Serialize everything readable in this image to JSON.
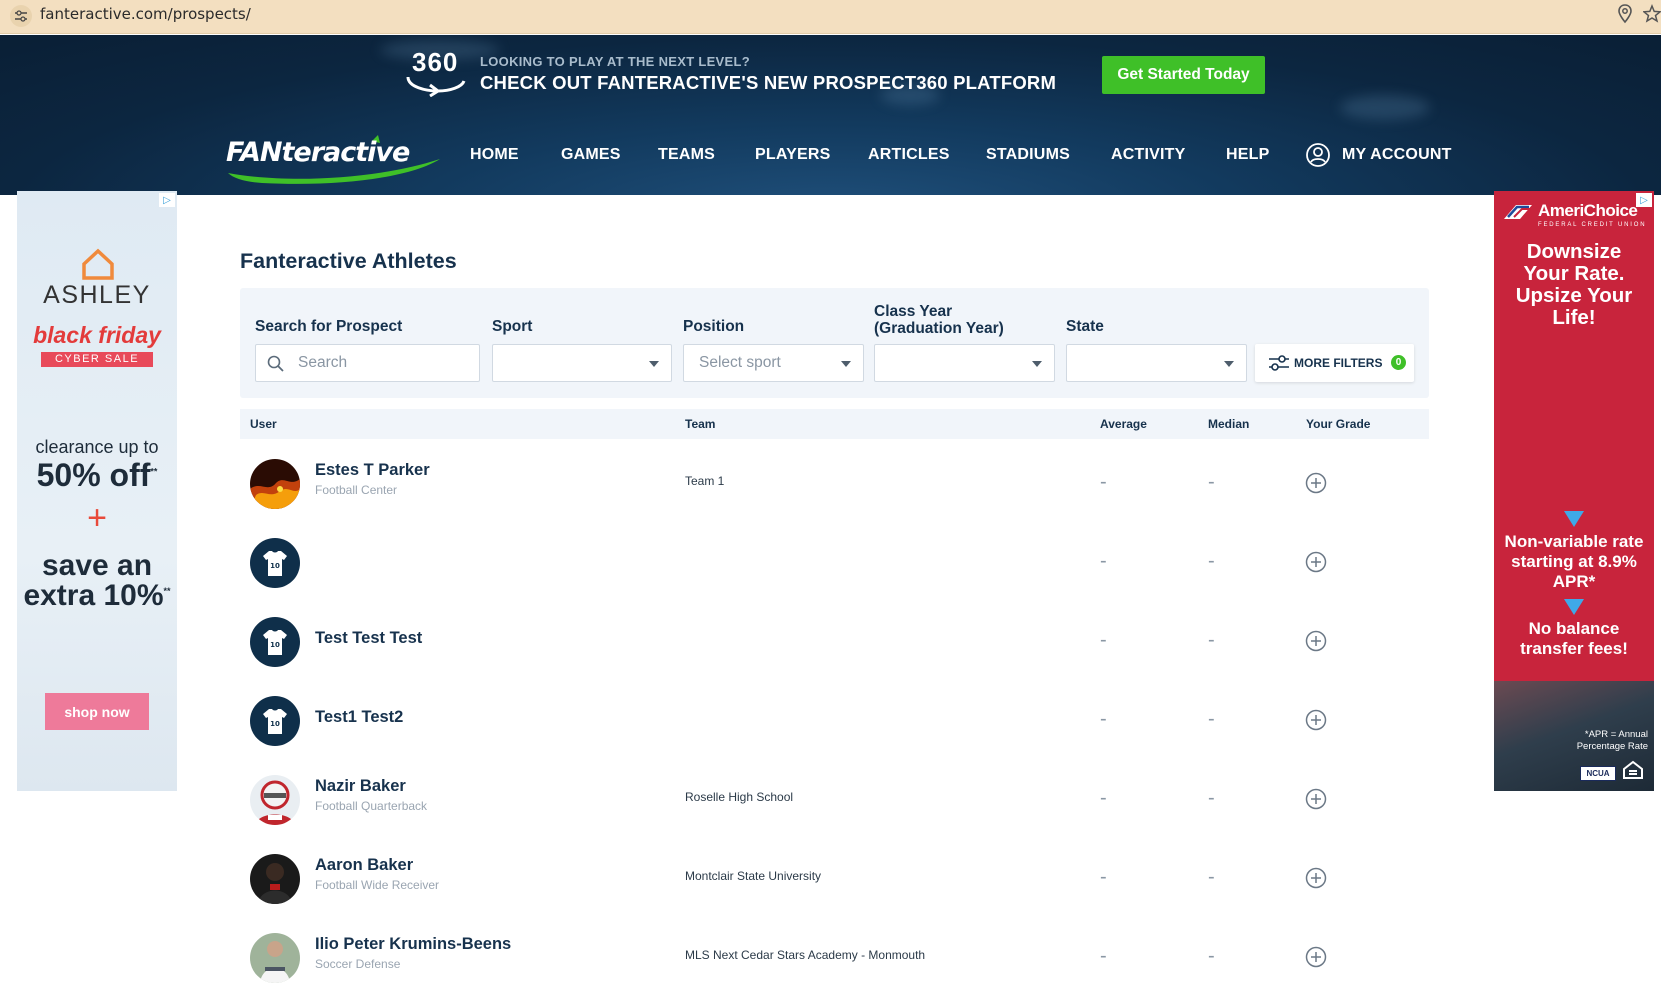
{
  "browser": {
    "url": "fanteractive.com/prospects/"
  },
  "promo": {
    "badge": "360",
    "small_text": "LOOKING TO PLAY AT THE NEXT LEVEL?",
    "big_text": "CHECK OUT FANTERACTIVE'S NEW PROSPECT360 PLATFORM",
    "cta_label": "Get Started Today",
    "cta_color": "#3fc028"
  },
  "header": {
    "brand_fan": "FAN",
    "brand_rest": "teractive",
    "nav": [
      "HOME",
      "GAMES",
      "TEAMS",
      "PLAYERS",
      "ARTICLES",
      "STADIUMS",
      "ACTIVITY",
      "HELP"
    ],
    "account_label": "MY ACCOUNT"
  },
  "ad_left": {
    "brand": "ASHLEY",
    "headline": "black friday",
    "tag": "CYBER SALE",
    "line1": "clearance up to",
    "line2": "50% off",
    "line2_sup": "**",
    "plus": "+",
    "line3": "save an",
    "line4": "extra 10%",
    "line4_sup": "**",
    "button": "shop now"
  },
  "ad_right": {
    "brand": "AmeriChoice",
    "brand_sub": "FEDERAL CREDIT UNION",
    "headline": "Downsize Your Rate. Upsize Your Life!",
    "bullet1": "Non-variable rate starting at 8.9% APR*",
    "bullet2": "No balance transfer fees!",
    "footnote": "*APR = Annual Percentage Rate",
    "ncua": "NCUA"
  },
  "main": {
    "title": "Fanteractive Athletes",
    "filters": {
      "search_label": "Search for Prospect",
      "search_placeholder": "Search",
      "sport_label": "Sport",
      "sport_value": "",
      "position_label": "Position",
      "position_placeholder": "Select sport",
      "class_label_1": "Class Year",
      "class_label_2": "(Graduation Year)",
      "class_value": "",
      "state_label": "State",
      "state_value": "",
      "more_label": "MORE FILTERS",
      "more_count": "0"
    },
    "table": {
      "headers": {
        "user": "User",
        "team": "Team",
        "average": "Average",
        "median": "Median",
        "grade": "Your Grade"
      },
      "rows": [
        {
          "name": "Estes T Parker",
          "position": "Football Center",
          "team": "Team 1",
          "average": "-",
          "median": "-",
          "avatar": "photo-fire"
        },
        {
          "name": "",
          "position": "",
          "team": "",
          "average": "-",
          "median": "-",
          "avatar": "jersey-icon",
          "jersey_number": "10"
        },
        {
          "name": "Test Test Test",
          "position": "",
          "team": "",
          "average": "-",
          "median": "-",
          "avatar": "jersey-icon",
          "jersey_number": "10"
        },
        {
          "name": "Test1 Test2",
          "position": "",
          "team": "",
          "average": "-",
          "median": "-",
          "avatar": "jersey-icon",
          "jersey_number": "10"
        },
        {
          "name": "Nazir Baker",
          "position": "Football Quarterback",
          "team": "Roselle High School",
          "average": "-",
          "median": "-",
          "avatar": "photo-football"
        },
        {
          "name": "Aaron Baker",
          "position": "Football Wide Receiver",
          "team": "Montclair State University",
          "average": "-",
          "median": "-",
          "avatar": "photo-dark"
        },
        {
          "name": "Ilio Peter Krumins-Beens",
          "position": "Soccer Defense",
          "team": "MLS Next Cedar Stars Academy - Monmouth",
          "average": "-",
          "median": "-",
          "avatar": "photo-soccer"
        }
      ]
    }
  }
}
